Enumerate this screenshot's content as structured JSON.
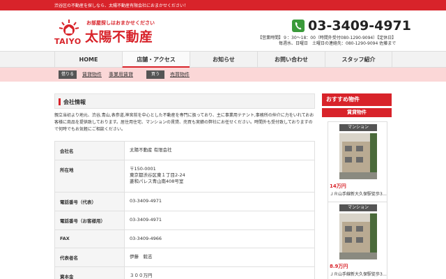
{
  "topbar": {
    "text": "渋谷区の不動産を探しなら、太陽不動産有限会社におまかせください！"
  },
  "logo": {
    "tagline": "お部屋探しはおまかせください",
    "name": "太陽不動産",
    "taiyo": "TAIYO",
    "brand_color": "#d8232a"
  },
  "contact": {
    "phone": "03-3409-4971",
    "hours_line1": "【営業時間】９：30〜18：00（時間外受付080-1290-9094）【定休日】",
    "hours_line2": "毎週水、日曜日　土曜日の連絡先：080-1290-9094 佐藤まで"
  },
  "nav": {
    "items": [
      {
        "label": "HOME"
      },
      {
        "label": "店舗・アクセス"
      },
      {
        "label": "お知らせ"
      },
      {
        "label": "お問い合わせ"
      },
      {
        "label": "スタッフ紹介"
      }
    ]
  },
  "subnav": {
    "rent_tag": "借りる",
    "rent_link": "賃貸物件",
    "biz_link": "事業用賃貸",
    "buy_tag": "買う",
    "buy_link": "売買物件"
  },
  "main": {
    "section_title": "会社情報",
    "intro": "親立当初より地元、渋谷,青山,表参道,神宮前を中心とした不動産を専門に扱っており、主に事業用テナント,事務所の仲介に力をいれておお客様に商品を提供致しております。居住用住宅、マンションの賃貸、売買も実績の弊社にお任せください。時間外も受付致しておりますので何時でもお気軽にご相談ください。",
    "rows": [
      {
        "key": "会社名",
        "value": "太陽不動産 有限会社"
      },
      {
        "key": "所在地",
        "value": "〒150-0001\n東京都渋谷区東１丁目2-24\n菱和パレス青山南408号室"
      },
      {
        "key": "電話番号（代表）",
        "value": "03-3409-4971"
      },
      {
        "key": "電話番号（お客様用）",
        "value": "03-3409-4971"
      },
      {
        "key": "FAX",
        "value": "03-3409-4966"
      },
      {
        "key": "代表者名",
        "value": "伊藤　毅志"
      },
      {
        "key": "資本金",
        "value": "３００万円"
      }
    ]
  },
  "sidebar": {
    "title": "おすすめ物件",
    "subtitle": "賃貸物件",
    "cards": [
      {
        "category": "マンション",
        "price": "14万円",
        "address": "ＪＲ山手線新大久保駅徒歩3…"
      },
      {
        "category": "マンション",
        "price": "8.9万円",
        "address": "ＪＲ山手線新大久保駅徒歩3…"
      }
    ]
  }
}
